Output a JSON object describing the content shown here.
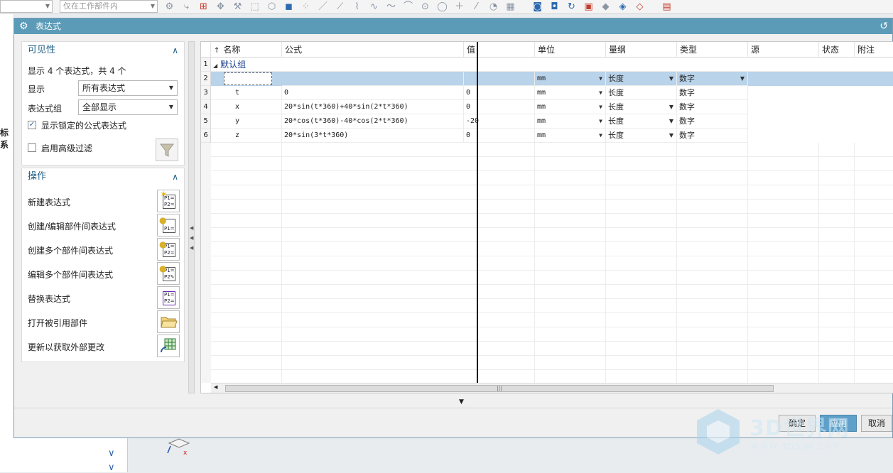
{
  "toolbar": {
    "left_combo": "",
    "scope_combo": "仅在工作部件内"
  },
  "background": {
    "side_text": "标系"
  },
  "dialog": {
    "title": "表达式",
    "visibility": {
      "heading": "可见性",
      "summary": "显示 4 个表达式，共 4 个",
      "display_label": "显示",
      "display_value": "所有表达式",
      "group_label": "表达式组",
      "group_value": "全部显示",
      "show_locked_label": "显示锁定的公式表达式",
      "show_locked_checked": true,
      "advanced_filter_label": "启用高级过滤",
      "advanced_filter_checked": false
    },
    "operations": {
      "heading": "操作",
      "items": [
        {
          "label": "新建表达式",
          "icon": "new-expression-icon"
        },
        {
          "label": "创建/编辑部件间表达式",
          "icon": "interpart-expression-icon"
        },
        {
          "label": "创建多个部件间表达式",
          "icon": "multiple-interpart-icon"
        },
        {
          "label": "编辑多个部件间表达式",
          "icon": "edit-multiple-interpart-icon"
        },
        {
          "label": "替换表达式",
          "icon": "replace-expression-icon"
        },
        {
          "label": "打开被引用部件",
          "icon": "open-folder-icon"
        },
        {
          "label": "更新以获取外部更改",
          "icon": "update-external-icon"
        }
      ]
    },
    "table": {
      "columns": [
        "名称",
        "公式",
        "值",
        "单位",
        "量纲",
        "类型",
        "源",
        "状态",
        "附注"
      ],
      "group_row": {
        "num": "1",
        "label": "默认组"
      },
      "rows": [
        {
          "num": "2",
          "name": "",
          "formula": "",
          "value": "",
          "unit": "mm",
          "dimension": "长度",
          "type": "数字"
        },
        {
          "num": "3",
          "name": "t",
          "formula": "0",
          "value": "0",
          "unit": "mm",
          "dimension": "长度",
          "type": "数字"
        },
        {
          "num": "4",
          "name": "x",
          "formula": "20*sin(t*360)+40*sin(2*t*360)",
          "value": "0",
          "unit": "mm",
          "dimension": "长度",
          "type": "数字"
        },
        {
          "num": "5",
          "name": "y",
          "formula": "20*cos(t*360)-40*cos(2*t*360)",
          "value": "-20",
          "unit": "mm",
          "dimension": "长度",
          "type": "数字"
        },
        {
          "num": "6",
          "name": "z",
          "formula": "20*sin(3*t*360)",
          "value": "0",
          "unit": "mm",
          "dimension": "长度",
          "type": "数字"
        }
      ]
    },
    "buttons": {
      "ok": "确定",
      "apply": "应用",
      "cancel": "取消"
    }
  },
  "watermark": {
    "brand": "3D世界网",
    "url": "WWW.3DSJW.COM"
  }
}
